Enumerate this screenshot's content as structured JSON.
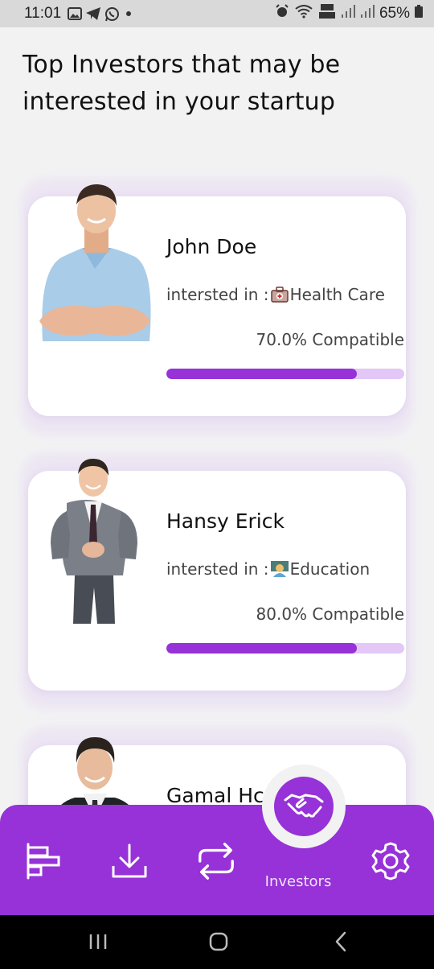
{
  "status_bar": {
    "time": "11:01",
    "battery": "65%",
    "icons": [
      "image-icon",
      "telegram-icon",
      "whatsapp-icon",
      "dot-icon",
      "alarm-icon",
      "wifi-icon",
      "volte-icon",
      "signal-icon",
      "signal-icon-2",
      "battery-icon"
    ]
  },
  "page": {
    "title": "Top Investors that may be interested in your startup"
  },
  "investors": [
    {
      "name": "John Doe",
      "interest_prefix": "intersted in :",
      "interest_icon": "medical-bag-emoji",
      "interest": "Health Care",
      "compat_label": "70.0% Compatible",
      "compat_value": 0.8
    },
    {
      "name": "Hansy Erick",
      "interest_prefix": "intersted in :",
      "interest_icon": "teacher-emoji",
      "interest": "Education",
      "compat_label": "80.0% Compatible",
      "compat_value": 0.8
    },
    {
      "name": "Gamal Hc"
    }
  ],
  "bottom_nav": {
    "items": [
      {
        "icon": "bar-chart-icon"
      },
      {
        "icon": "download-icon"
      },
      {
        "icon": "repeat-icon"
      },
      {
        "icon": "handshake-icon",
        "label": "Investors",
        "active": true
      },
      {
        "icon": "settings-icon"
      }
    ]
  },
  "colors": {
    "accent": "#9632d8",
    "progress_track": "#e2c7f7",
    "background": "#f2f2f3"
  }
}
